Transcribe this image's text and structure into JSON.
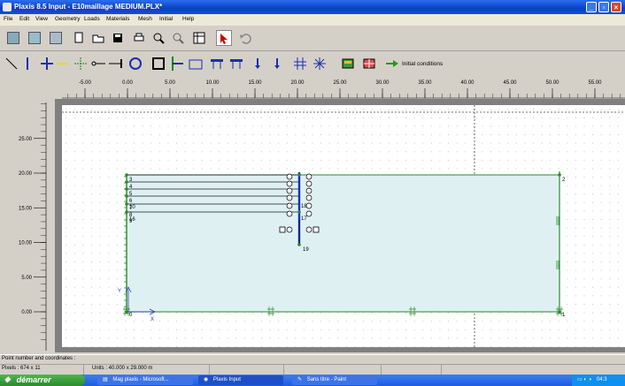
{
  "window": {
    "title": "Plaxis 8.5 Input - E10maillage MEDIUM.PLX*"
  },
  "menu": [
    "File",
    "Edit",
    "View",
    "Geometry",
    "Loads",
    "Materials",
    "Mesh",
    "Initial",
    "Help"
  ],
  "toolbar2": {
    "initial_conditions_label": "Initial conditions"
  },
  "ruler_x": [
    "-5.00",
    "0.00",
    "5.00",
    "10.00",
    "15.00",
    "20.00",
    "25.00",
    "30.00",
    "35.00",
    "40.00",
    "45.00",
    "50.00",
    "55.00"
  ],
  "ruler_y": [
    "25.00",
    "20.00",
    "15.00",
    "10.00",
    "5.00",
    "0.00"
  ],
  "canvas": {
    "point_labels": [
      "0",
      "1",
      "2",
      "3",
      "4",
      "5",
      "6",
      "7",
      "8",
      "9",
      "10",
      "16",
      "17",
      "18",
      "19"
    ],
    "axis_x_label": "X",
    "axis_y_label": "Y",
    "soil_color": "#dff0f3",
    "outline_color": "#2a8a2a",
    "anchor_color": "#1a2fb0"
  },
  "status": {
    "line1": "Point number and coordinates :",
    "pixels": "Pixels : 674 x 11",
    "units": "Units : 40.000 x 29.000 m"
  },
  "taskbar": {
    "start": "démarrer",
    "tasks": [
      "Mag plaxis - Microsoft...",
      "Plaxis Input",
      "Sans titre - Paint"
    ],
    "clock": "04:3"
  }
}
